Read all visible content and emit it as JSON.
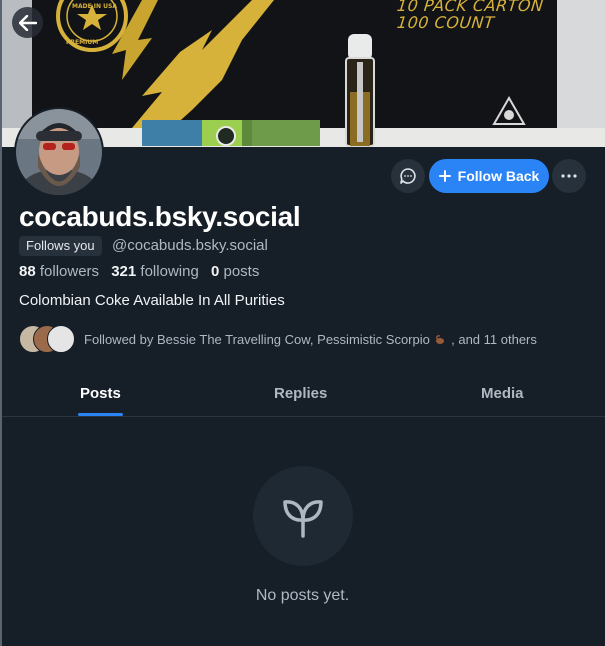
{
  "banner": {
    "box_text_line1": "10 PACK CARTON",
    "box_text_line2": "100 COUNT",
    "seal_text_top": "MADE IN USA",
    "seal_text_bottom": "PREMIUM",
    "accent_color": "#d7b23a"
  },
  "header": {
    "back_icon": "arrow-left-icon"
  },
  "actions": {
    "message_icon": "chat-bubble-icon",
    "follow_label": "Follow Back",
    "more_icon": "ellipsis-icon",
    "accent": "#2a84f5"
  },
  "profile": {
    "display_name": "cocabuds.bsky.social",
    "follows_you_label": "Follows you",
    "handle": "@cocabuds.bsky.social",
    "followers_count": "88",
    "followers_label": "followers",
    "following_count": "321",
    "following_label": "following",
    "posts_count": "0",
    "posts_label": "posts",
    "bio": "Colombian Coke Available In All Purities",
    "followed_by_prefix": "Followed by Bessie The Travelling Cow, Pessimistic Scorpio",
    "followed_by_suffix": ", and 11 others"
  },
  "tabs": [
    {
      "label": "Posts",
      "active": true
    },
    {
      "label": "Replies",
      "active": false
    },
    {
      "label": "Media",
      "active": false
    }
  ],
  "empty_state": {
    "icon": "sprout-icon",
    "message": "No posts yet."
  }
}
